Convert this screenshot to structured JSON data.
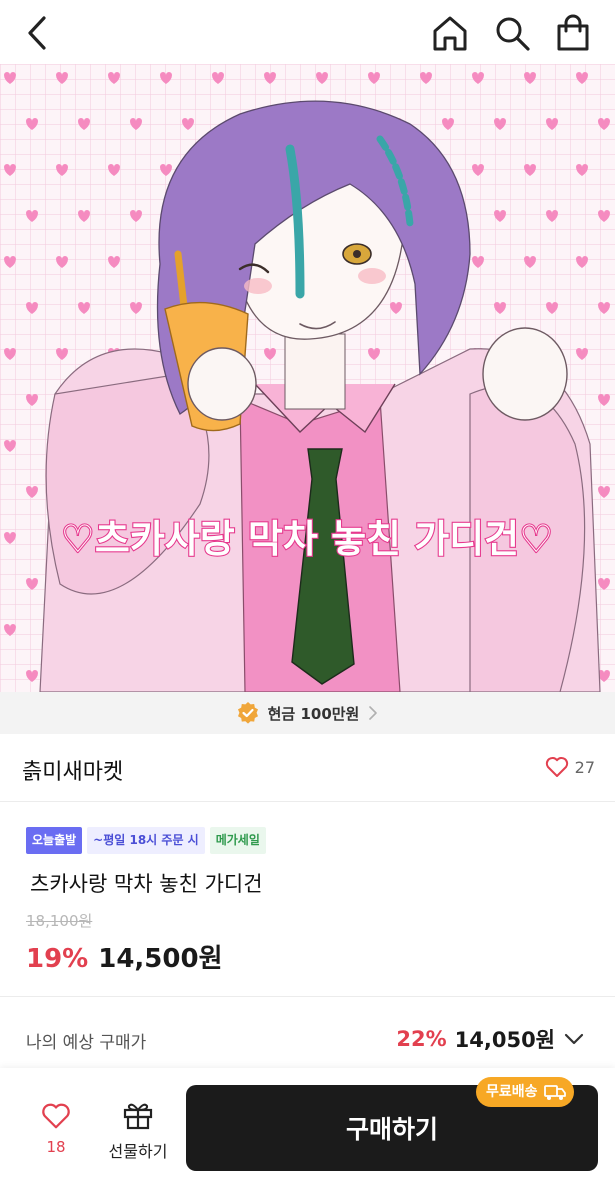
{
  "nav": {
    "back_icon": "chevron-left-icon",
    "home_icon": "home-icon",
    "search_icon": "search-icon",
    "bag_icon": "shopping-bag-icon"
  },
  "artwork": {
    "caption": "♡츠카사랑 막차 놓친 가디건♡"
  },
  "banner": {
    "text": "현금 100만원",
    "icon": "verified-badge-icon",
    "accent": "#f0a63a"
  },
  "shop": {
    "name": "츩미새마켓",
    "like_count": "27"
  },
  "tags": {
    "today_ship": "오늘출발",
    "order_cutoff": "~평일 18시 주문 시",
    "mega_sale": "메가세일"
  },
  "product": {
    "title": "츠카사랑 막차 놓친 가디건",
    "original_price": "18,100원",
    "discount": "19%",
    "price": "14,500원"
  },
  "expected": {
    "label": "나의 예상 구매가",
    "discount": "22%",
    "price": "14,050원"
  },
  "bottom": {
    "wish_count": "18",
    "gift_label": "선물하기",
    "buy_label": "구매하기",
    "free_shipping": "무료배송"
  },
  "colors": {
    "accent_red": "#e2404f",
    "buy_button": "#1b1b1b",
    "shipping_badge": "#f7a825",
    "tag_blue": "#6a6df2"
  }
}
